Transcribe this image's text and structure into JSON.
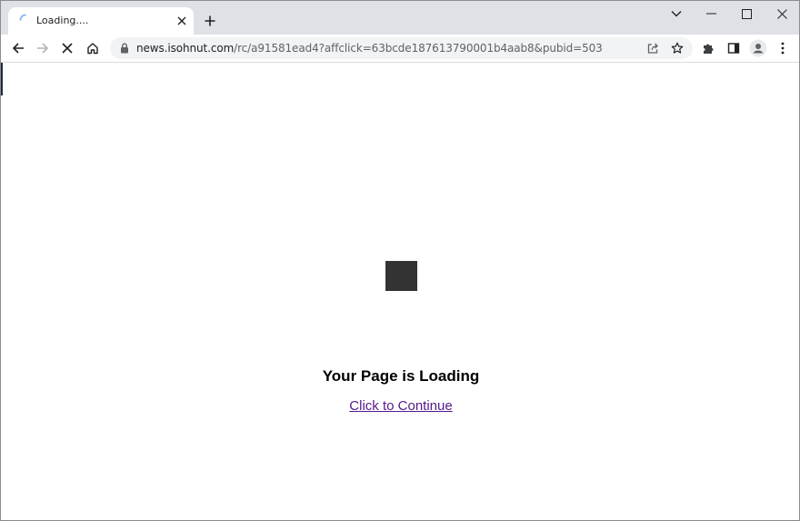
{
  "browser": {
    "tab": {
      "title": "Loading...."
    },
    "address_bar": {
      "url_host": "news.isohnut.com",
      "url_path": "/rc/a91581ead4?affclick=63bcde187613790001b4aab8&pubid=503"
    },
    "icons": {
      "tab_spinner": "loading-spinner-icon",
      "tab_close": "close-icon",
      "new_tab": "plus-icon",
      "tab_search": "chevron-down-icon",
      "minimize": "minimize-icon",
      "maximize": "maximize-icon",
      "close_window": "close-icon",
      "back": "back-arrow-icon",
      "forward": "forward-arrow-icon",
      "stop": "stop-icon",
      "home": "home-icon",
      "lock": "lock-icon",
      "share": "share-icon",
      "bookmark": "star-icon",
      "extensions": "puzzle-icon",
      "side_panel": "side-panel-icon",
      "profile": "profile-icon",
      "menu": "kebab-menu-icon"
    }
  },
  "page": {
    "heading": "Your Page is Loading",
    "continue_link": "Click to Continue"
  },
  "colors": {
    "tab_strip": "#dee1e6",
    "link_visited": "#551a8b",
    "loader": "#333333"
  }
}
